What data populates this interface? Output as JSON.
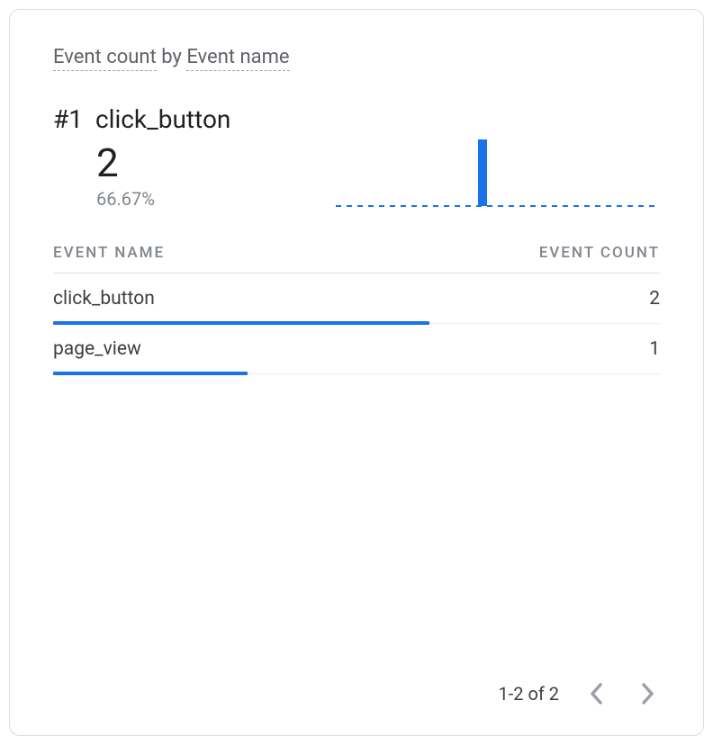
{
  "title": {
    "metric": "Event count",
    "by": " by ",
    "dimension": "Event name"
  },
  "hero": {
    "rank": "#1",
    "name": "click_button",
    "value": "2",
    "pct": "66.67%"
  },
  "columns": {
    "name": "EVENT NAME",
    "count": "EVENT COUNT"
  },
  "rows": [
    {
      "name": "click_button",
      "value": "2",
      "bar_pct": 62
    },
    {
      "name": "page_view",
      "value": "1",
      "bar_pct": 32
    }
  ],
  "pager": {
    "label": "1-2 of 2"
  },
  "colors": {
    "accent": "#1a73e8"
  },
  "chart_data": {
    "type": "bar",
    "title": "Event count by Event name",
    "xlabel": "Event name",
    "ylabel": "Event count",
    "categories": [
      "click_button",
      "page_view"
    ],
    "values": [
      2,
      1
    ],
    "ylim": [
      0,
      2
    ]
  }
}
